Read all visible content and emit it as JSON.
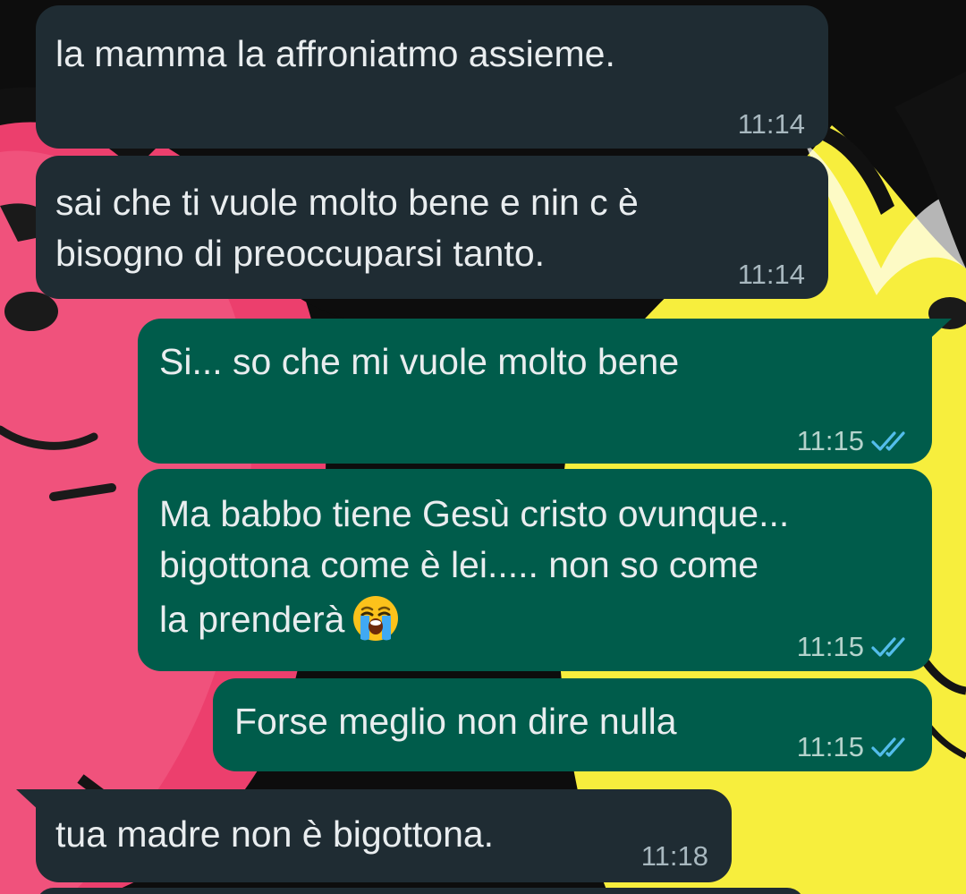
{
  "colors": {
    "incoming_bubble": "#1f2c33",
    "outgoing_bubble": "#005c4b",
    "text": "#e9edef",
    "read_ticks": "#53bdeb"
  },
  "messages": [
    {
      "direction": "incoming",
      "lines": [
        "la mamma la affroniatmo assieme."
      ],
      "time": "11:14"
    },
    {
      "direction": "incoming",
      "lines": [
        "sai che ti vuole molto bene e nin c è",
        "bisogno di preoccuparsi tanto."
      ],
      "time": "11:14"
    },
    {
      "direction": "outgoing",
      "lines": [
        "Si... so che mi vuole molto bene"
      ],
      "time": "11:15",
      "status": "read",
      "status_icon": "double-check-icon"
    },
    {
      "direction": "outgoing",
      "lines": [
        "Ma babbo tiene Gesù cristo ovunque...",
        "bigottona come è lei..... non so come",
        "la prenderà"
      ],
      "emoji": "loudly-crying-face-emoji",
      "time": "11:15",
      "status": "read",
      "status_icon": "double-check-icon"
    },
    {
      "direction": "outgoing",
      "lines": [
        "Forse meglio non dire nulla"
      ],
      "time": "11:15",
      "status": "read",
      "status_icon": "double-check-icon"
    },
    {
      "direction": "incoming",
      "lines": [
        "tua madre non è bigottona."
      ],
      "time": "11:18"
    }
  ]
}
